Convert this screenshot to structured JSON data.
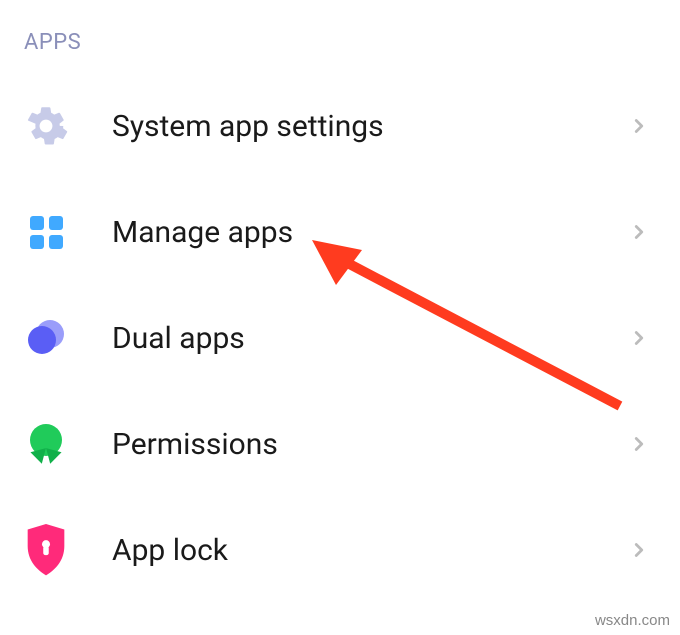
{
  "section": {
    "header": "APPS",
    "items": [
      {
        "label": "System app settings",
        "icon": "gear"
      },
      {
        "label": "Manage apps",
        "icon": "grid"
      },
      {
        "label": "Dual apps",
        "icon": "dual"
      },
      {
        "label": "Permissions",
        "icon": "permissions"
      },
      {
        "label": "App lock",
        "icon": "shield"
      }
    ]
  },
  "watermark": "wsxdn.com",
  "colors": {
    "header": "#8a8fb9",
    "chevron": "#bcbcbc",
    "arrow": "#ff3b1f"
  }
}
